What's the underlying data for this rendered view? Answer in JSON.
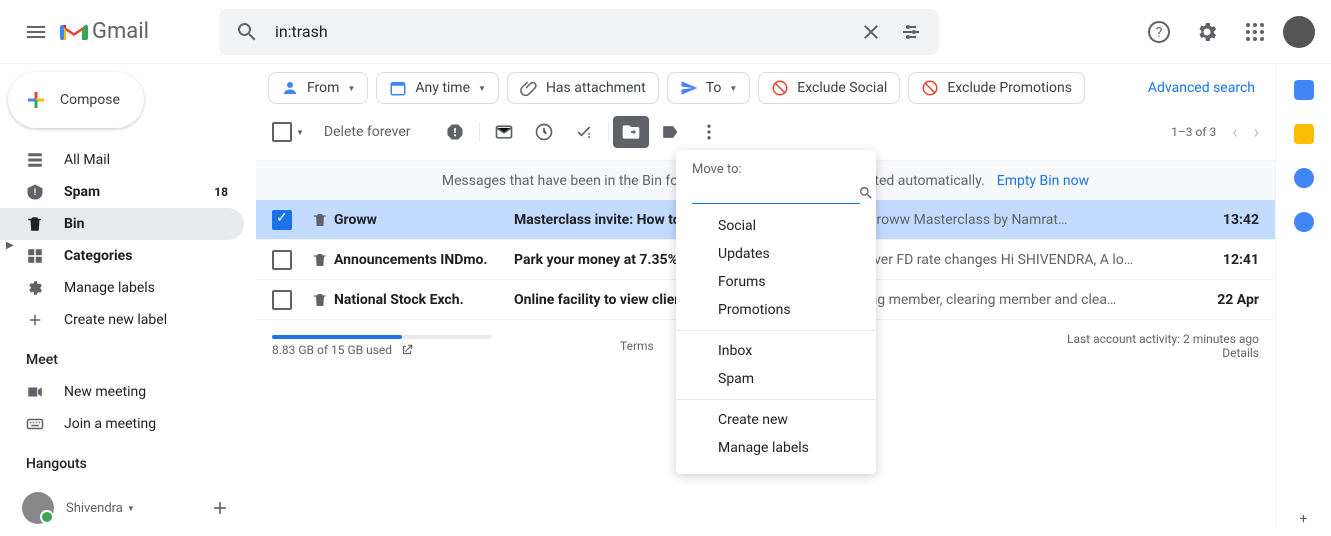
{
  "header": {
    "logo_text": "Gmail",
    "search_value": "in:trash"
  },
  "compose_label": "Compose",
  "nav": {
    "all_mail": "All Mail",
    "spam": "Spam",
    "spam_count": "18",
    "bin": "Bin",
    "categories": "Categories",
    "manage_labels": "Manage labels",
    "create_label": "Create new label"
  },
  "meet": {
    "title": "Meet",
    "new_meeting": "New meeting",
    "join_meeting": "Join a meeting"
  },
  "hangouts": {
    "title": "Hangouts",
    "user": "Shivendra"
  },
  "filters": {
    "from": "From",
    "any_time": "Any time",
    "has_attachment": "Has attachment",
    "to": "To",
    "exclude_social": "Exclude Social",
    "exclude_promotions": "Exclude Promotions",
    "advanced_search": "Advanced search"
  },
  "toolbar": {
    "delete_forever": "Delete forever",
    "pager": "1–3 of 3"
  },
  "banner": {
    "text": "Messages that have been in the Bin for more than 30 days will be deleted automatically.",
    "empty": "Empty Bin now"
  },
  "rows": [
    {
      "sender": "Groww",
      "subject": "Masterclass invite: How to pick mutual funds? | 24 Apr",
      "snippet": " - Groww Masterclass by Namrat…",
      "time": "13:42",
      "selected": true,
      "unread": true
    },
    {
      "sender": "Announcements INDmo.",
      "subject": "Park your money at 7.35% with Super Saver FD",
      "snippet": " - Super Saver FD rate changes Hi SHIVENDRA, A lo…",
      "time": "12:41",
      "selected": false,
      "unread": true
    },
    {
      "sender": "National Stock Exch.",
      "subject": "Online facility to view client collaterals",
      "snippet": " - placed with trading member, clearing member and clea…",
      "time": "22 Apr",
      "selected": false,
      "unread": true
    }
  ],
  "moveto": {
    "title": "Move to:",
    "categories": [
      "Social",
      "Updates",
      "Forums",
      "Promotions"
    ],
    "folders": [
      "Inbox",
      "Spam"
    ],
    "actions": [
      "Create new",
      "Manage labels"
    ]
  },
  "footer": {
    "storage": "8.83 GB of 15 GB used",
    "terms": "Terms",
    "activity": "Last account activity: 2 minutes ago",
    "details": "Details"
  }
}
